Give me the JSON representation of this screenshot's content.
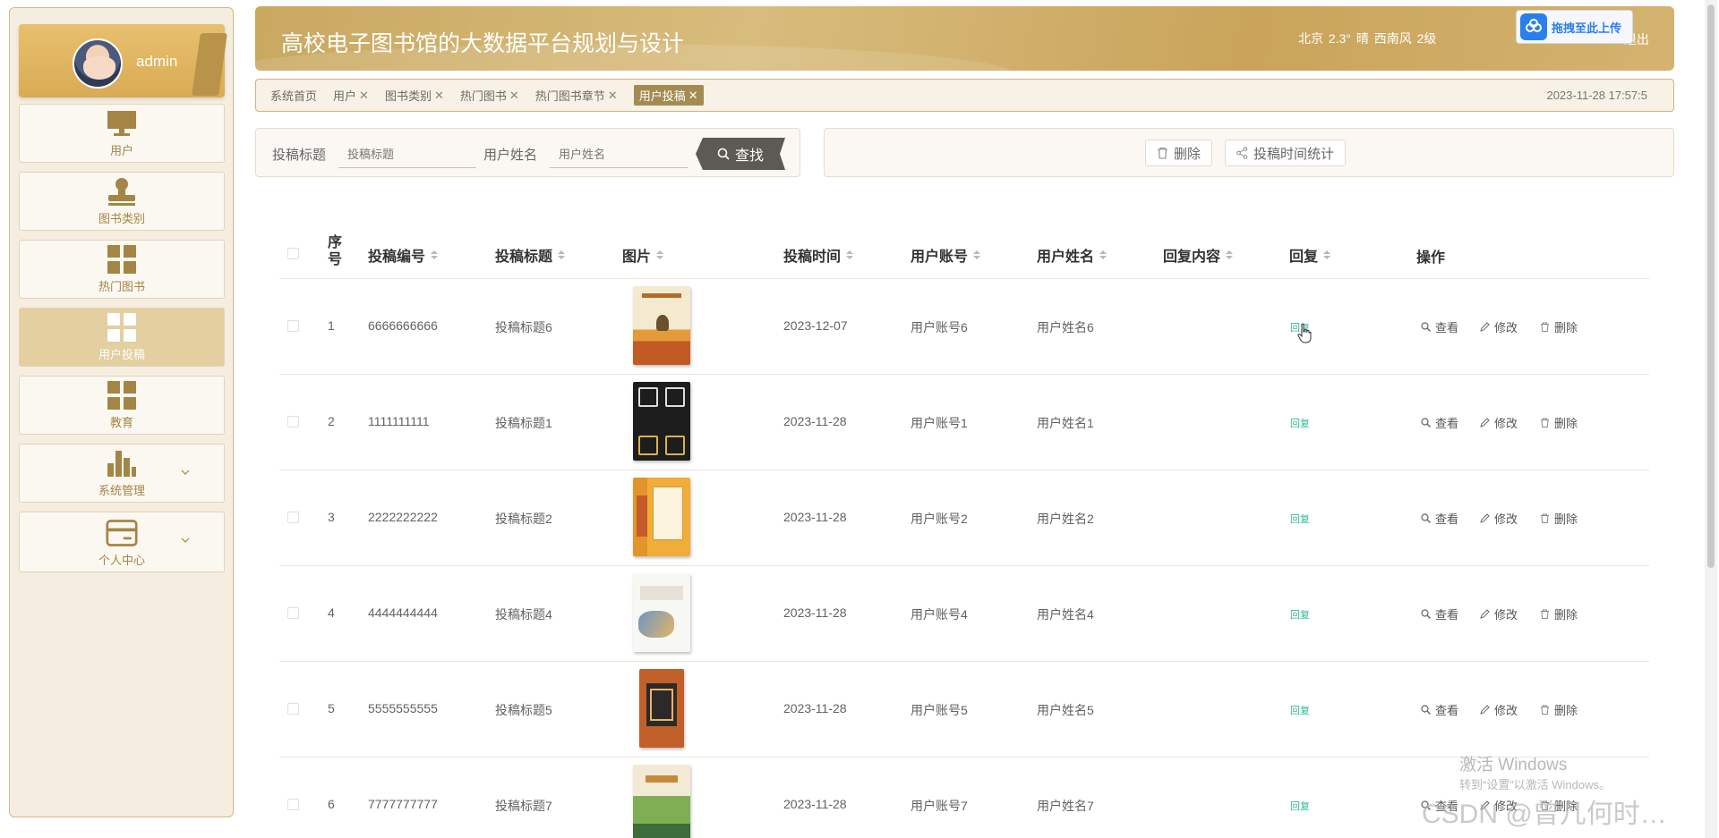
{
  "app": {
    "user": "admin",
    "title": "高校电子图书馆的大数据平台规划与设计",
    "weather": "北京  2.3°  晴  西南风  2级",
    "logout": "退出",
    "upload": "拖拽至此上传",
    "datetime": "2023-11-28 17:57:5"
  },
  "sidebar": {
    "items": [
      {
        "label": "用户",
        "icon": "monitor-icon"
      },
      {
        "label": "图书类别",
        "icon": "stamp-icon"
      },
      {
        "label": "热门图书",
        "icon": "grid-icon"
      },
      {
        "label": "用户投稿",
        "icon": "grid-icon",
        "active": true
      },
      {
        "label": "教育",
        "icon": "grid-icon"
      },
      {
        "label": "系统管理",
        "icon": "bar-chart-icon"
      },
      {
        "label": "个人中心",
        "icon": "card-icon"
      }
    ]
  },
  "tabs": [
    {
      "label": "系统首页",
      "closable": false
    },
    {
      "label": "用户",
      "closable": true
    },
    {
      "label": "图书类别",
      "closable": true
    },
    {
      "label": "热门图书",
      "closable": true
    },
    {
      "label": "热门图书章节",
      "closable": true
    },
    {
      "label": "用户投稿",
      "closable": true,
      "active": true
    }
  ],
  "search": {
    "title_label": "投稿标题",
    "title_placeholder": "投稿标题",
    "name_label": "用户姓名",
    "name_placeholder": "用户姓名",
    "button": "查找"
  },
  "actions": {
    "delete": "删除",
    "stats": "投稿时间统计"
  },
  "table": {
    "headers": {
      "index": "序号",
      "code": "投稿编号",
      "title": "投稿标题",
      "image": "图片",
      "time": "投稿时间",
      "account": "用户账号",
      "name": "用户姓名",
      "reply_content": "回复内容",
      "reply": "回复",
      "ops": "操作"
    },
    "rows": [
      {
        "index": "1",
        "code": "6666666666",
        "title": "投稿标题6",
        "time": "2023-12-07",
        "account": "用户账号6",
        "name": "用户姓名6",
        "reply": "回复"
      },
      {
        "index": "2",
        "code": "1111111111",
        "title": "投稿标题1",
        "time": "2023-11-28",
        "account": "用户账号1",
        "name": "用户姓名1",
        "reply": "回复"
      },
      {
        "index": "3",
        "code": "2222222222",
        "title": "投稿标题2",
        "time": "2023-11-28",
        "account": "用户账号2",
        "name": "用户姓名2",
        "reply": "回复"
      },
      {
        "index": "4",
        "code": "4444444444",
        "title": "投稿标题4",
        "time": "2023-11-28",
        "account": "用户账号4",
        "name": "用户姓名4",
        "reply": "回复"
      },
      {
        "index": "5",
        "code": "5555555555",
        "title": "投稿标题5",
        "time": "2023-11-28",
        "account": "用户账号5",
        "name": "用户姓名5",
        "reply": "回复"
      },
      {
        "index": "6",
        "code": "7777777777",
        "title": "投稿标题7",
        "time": "2023-11-28",
        "account": "用户账号7",
        "name": "用户姓名7",
        "reply": "回复"
      }
    ],
    "op_labels": {
      "view": "查看",
      "edit": "修改",
      "delete": "删除"
    }
  },
  "overlay": {
    "win_activate": "激活 Windows",
    "win_hint": "转到“设置”以激活 Windows。",
    "csdn": "CSDN @曾几何时…"
  },
  "colors": {
    "accent": "#c9a860",
    "active_tab": "#a48b52",
    "reply": "#34b59a"
  }
}
